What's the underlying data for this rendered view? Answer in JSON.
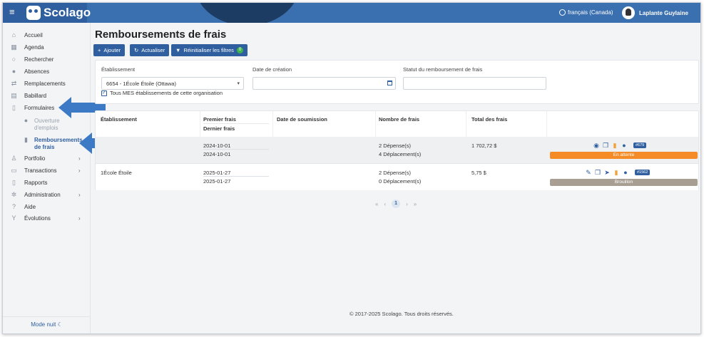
{
  "app": {
    "brand": "Scolago"
  },
  "header": {
    "language": "français (Canada)",
    "user_name": "Laplante Guylaine"
  },
  "sidebar": {
    "items": [
      {
        "label": "Accueil",
        "icon": "home-icon"
      },
      {
        "label": "Agenda",
        "icon": "calendar-icon"
      },
      {
        "label": "Rechercher",
        "icon": "search-icon"
      },
      {
        "label": "Absences",
        "icon": "user-minus-icon"
      },
      {
        "label": "Remplacements",
        "icon": "swap-icon"
      },
      {
        "label": "Babillard",
        "icon": "board-icon"
      },
      {
        "label": "Formulaires",
        "icon": "form-icon"
      },
      {
        "label": "Ouverture d'emplois",
        "icon": "user-plus-icon"
      },
      {
        "label": "Remboursements de frais",
        "icon": "document-icon"
      },
      {
        "label": "Portfolio",
        "icon": "trophy-icon"
      },
      {
        "label": "Transactions",
        "icon": "transactions-icon"
      },
      {
        "label": "Rapports",
        "icon": "report-icon"
      },
      {
        "label": "Administration",
        "icon": "gear-icon"
      },
      {
        "label": "Aide",
        "icon": "help-icon"
      },
      {
        "label": "Évolutions",
        "icon": "sprout-icon"
      }
    ],
    "night_mode": "Mode nuit"
  },
  "page": {
    "title": "Remboursements de frais",
    "buttons": {
      "add": "Ajouter",
      "refresh": "Actualiser",
      "reset": "Réinitialiser les filtres",
      "reset_count": "0"
    }
  },
  "filters": {
    "establishment_label": "Établissement",
    "establishment_value": "6654 - 1École Étoile (Ottawa)",
    "created_label": "Date de création",
    "created_value": "",
    "status_label": "Statut du remboursement de frais",
    "status_value": "",
    "checkbox_label": "Tous MES établissements de cette organisation"
  },
  "table": {
    "headers": {
      "establishment": "Établissement",
      "first": "Premier frais",
      "last": "Dernier frais",
      "submitted": "Date de soumission",
      "count": "Nombre de frais",
      "total": "Total des frais"
    },
    "rows": [
      {
        "establishment": "",
        "first": "2024-10-01",
        "last": "2024-10-01",
        "submitted": "",
        "count_a": "2 Dépense(s)",
        "count_b": "4 Déplacement(s)",
        "total": "1 702,72 $",
        "id": "#679",
        "status": "En attente",
        "status_color": "#f58b26"
      },
      {
        "establishment": "1École Étoile",
        "first": "2025-01-27",
        "last": "2025-01-27",
        "submitted": "",
        "count_a": "2 Dépense(s)",
        "count_b": "0 Déplacement(s)",
        "total": "5,75 $",
        "id": "#1562",
        "status": "Brouillon",
        "status_color": "#a89e92"
      }
    ]
  },
  "pager": {
    "current": "1",
    "first": "«",
    "prev": "‹",
    "next": "›",
    "last": "»"
  },
  "footer": {
    "text": "© 2017-2025 Scolago. Tous droits réservés."
  }
}
